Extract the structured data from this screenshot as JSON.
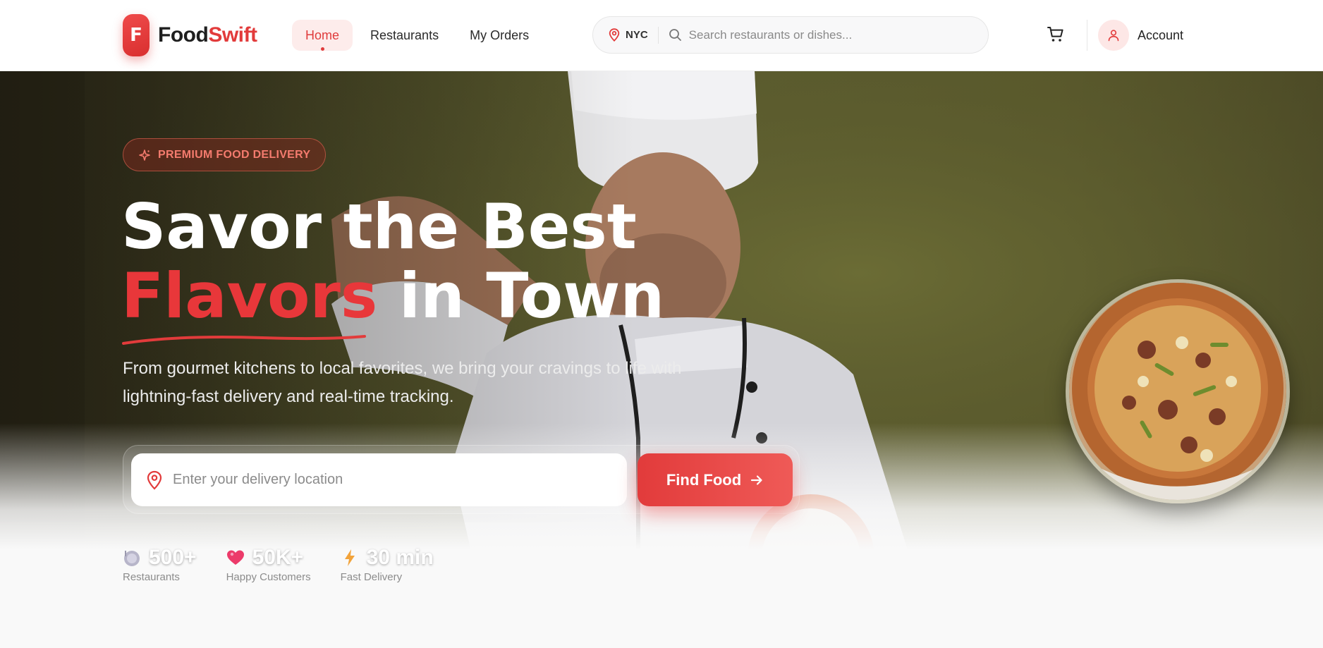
{
  "header": {
    "logo": {
      "initial": "F",
      "name_part1": "Food",
      "name_part2": "Swift"
    },
    "nav": [
      {
        "label": "Home",
        "active": true
      },
      {
        "label": "Restaurants",
        "active": false
      },
      {
        "label": "My Orders",
        "active": false
      }
    ],
    "search": {
      "location": "NYC",
      "placeholder": "Search restaurants or dishes..."
    },
    "icons": {
      "location": "map-pin-icon",
      "search": "search-icon",
      "cart": "cart-icon",
      "account": "user-icon"
    },
    "account_label": "Account"
  },
  "hero": {
    "badge": "PREMIUM FOOD DELIVERY",
    "headline_line1": "Savor the Best",
    "headline_accent": "Flavors",
    "headline_line2_rest": " in Town",
    "subtitle": "From gourmet kitchens to local favorites, we bring your cravings to life with lightning-fast delivery and real-time tracking.",
    "location_placeholder": "Enter your delivery location",
    "find_button": "Find Food",
    "stats": [
      {
        "icon": "plate-icon",
        "value": "500+",
        "label": "Restaurants"
      },
      {
        "icon": "heart-icon",
        "value": "50K+",
        "label": "Happy Customers"
      },
      {
        "icon": "lightning-icon",
        "value": "30 min",
        "label": "Fast Delivery"
      }
    ]
  },
  "colors": {
    "brand_red": "#e23b3b",
    "nav_active_bg": "#fdeceb",
    "hero_olive": "#5d5e2f",
    "text_dark": "#1f1f1f"
  }
}
